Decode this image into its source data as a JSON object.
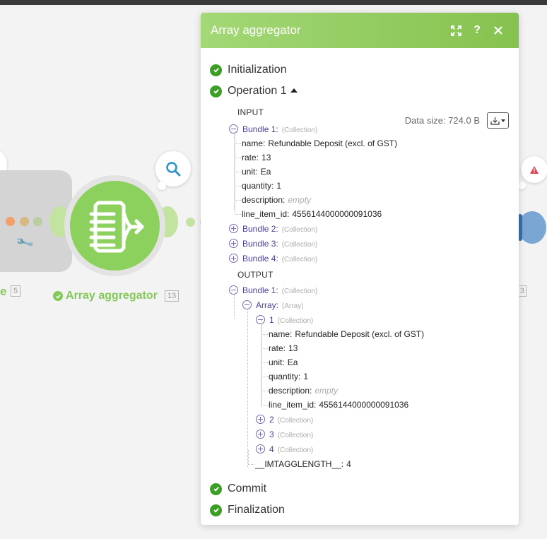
{
  "canvas": {
    "left_module_label": "e",
    "left_module_badge": "5",
    "module_name": "Array aggregator",
    "module_badge": "13",
    "right_badge": "3"
  },
  "panel": {
    "title": "Array aggregator",
    "stages": {
      "initialization": "Initialization",
      "operation": "Operation 1",
      "commit": "Commit",
      "finalization": "Finalization"
    },
    "data_size": "Data size: 724.0 B",
    "input_label": "INPUT",
    "output_label": "OUTPUT",
    "input": {
      "bundle1": {
        "label": "Bundle 1:",
        "type": "(Collection)"
      },
      "fields": [
        {
          "key": "name:",
          "value": "Refundable Deposit (excl. of GST)"
        },
        {
          "key": "rate:",
          "value": "13"
        },
        {
          "key": "unit:",
          "value": "Ea"
        },
        {
          "key": "quantity:",
          "value": "1"
        },
        {
          "key": "description:",
          "value": "empty"
        },
        {
          "key": "line_item_id:",
          "value": "4556144000000091036"
        }
      ],
      "collapsed": [
        {
          "label": "Bundle 2:",
          "type": "(Collection)"
        },
        {
          "label": "Bundle 3:",
          "type": "(Collection)"
        },
        {
          "label": "Bundle 4:",
          "type": "(Collection)"
        }
      ]
    },
    "output": {
      "bundle1": {
        "label": "Bundle 1:",
        "type": "(Collection)"
      },
      "array": {
        "label": "Array:",
        "type": "(Array)"
      },
      "item1": {
        "label": "1",
        "type": "(Collection)"
      },
      "fields": [
        {
          "key": "name:",
          "value": "Refundable Deposit (excl. of GST)"
        },
        {
          "key": "rate:",
          "value": "13"
        },
        {
          "key": "unit:",
          "value": "Ea"
        },
        {
          "key": "quantity:",
          "value": "1"
        },
        {
          "key": "description:",
          "value": "empty"
        },
        {
          "key": "line_item_id:",
          "value": "4556144000000091036"
        }
      ],
      "collapsed": [
        {
          "label": "2",
          "type": "(Collection)"
        },
        {
          "label": "3",
          "type": "(Collection)"
        },
        {
          "label": "4",
          "type": "(Collection)"
        }
      ],
      "length": {
        "key": "__IMTAGGLENGTH__:",
        "value": "4"
      }
    }
  },
  "icons": {
    "header": [
      "expand-icon",
      "help-icon",
      "close-icon"
    ],
    "module": "array-aggregator-icon",
    "search": "search-icon",
    "warning": "warning-icon",
    "wrench": "wrench-icon",
    "download": "download-icon"
  },
  "colors": {
    "brand_green": "#86c24f",
    "check_green": "#3a9f24",
    "tree_accent": "#4c3f99"
  }
}
